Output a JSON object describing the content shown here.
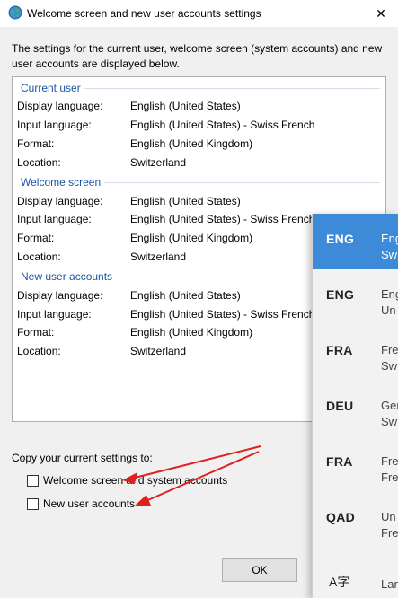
{
  "window": {
    "title": "Welcome screen and new user accounts settings",
    "close_glyph": "✕",
    "icon": "globe-icon"
  },
  "description": "The settings for the current user, welcome screen (system accounts) and new user accounts are displayed below.",
  "sections": [
    {
      "header": "Current user",
      "rows": [
        {
          "label": "Display language:",
          "value": "English (United States)"
        },
        {
          "label": "Input language:",
          "value": "English (United States) - Swiss French"
        },
        {
          "label": "Format:",
          "value": "English (United Kingdom)"
        },
        {
          "label": "Location:",
          "value": "Switzerland"
        }
      ]
    },
    {
      "header": "Welcome screen",
      "rows": [
        {
          "label": "Display language:",
          "value": "English (United States)"
        },
        {
          "label": "Input language:",
          "value": "English (United States) - Swiss French"
        },
        {
          "label": "Format:",
          "value": "English (United Kingdom)"
        },
        {
          "label": "Location:",
          "value": "Switzerland"
        }
      ]
    },
    {
      "header": "New user accounts",
      "rows": [
        {
          "label": "Display language:",
          "value": "English (United States)"
        },
        {
          "label": "Input language:",
          "value": "English (United States) - Swiss French"
        },
        {
          "label": "Format:",
          "value": "English (United Kingdom)"
        },
        {
          "label": "Location:",
          "value": "Switzerland"
        }
      ]
    }
  ],
  "copy_settings": {
    "label": "Copy your current settings to:",
    "options": [
      {
        "label": "Welcome screen and system accounts",
        "checked": false
      },
      {
        "label": "New user accounts",
        "checked": false
      }
    ]
  },
  "buttons": {
    "ok": "OK"
  },
  "input_flyout": {
    "items": [
      {
        "code": "ENG",
        "line1": "Eng",
        "line2": "Sw",
        "selected": true
      },
      {
        "code": "ENG",
        "line1": "Eng",
        "line2": "Un",
        "selected": false
      },
      {
        "code": "FRA",
        "line1": "Fre",
        "line2": "Sw",
        "selected": false
      },
      {
        "code": "DEU",
        "line1": "Ger",
        "line2": "Sw",
        "selected": false
      },
      {
        "code": "FRA",
        "line1": "Fre",
        "line2": "Fre",
        "selected": false
      },
      {
        "code": "QAD",
        "line1": "Un",
        "line2": "Fre",
        "selected": false
      }
    ],
    "preferences": {
      "glyph": "A字",
      "label": "Lan"
    }
  },
  "colors": {
    "section_header": "#1a56a6",
    "flyout_selected": "#3c8ad8",
    "annotation_arrow": "#e02020"
  }
}
